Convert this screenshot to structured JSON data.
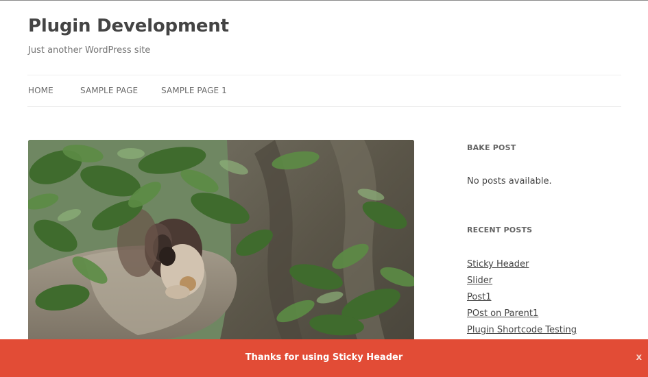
{
  "site": {
    "title": "Plugin Development",
    "tagline": "Just another WordPress site"
  },
  "nav": {
    "items": [
      {
        "label": "HOME"
      },
      {
        "label": "SAMPLE PAGE"
      },
      {
        "label": "SAMPLE PAGE 1"
      }
    ]
  },
  "featured_image": {
    "alt": "squirrel in a tree"
  },
  "sidebar": {
    "bake_post": {
      "title": "BAKE POST",
      "text": "No posts available."
    },
    "recent_posts": {
      "title": "RECENT POSTS",
      "items": [
        {
          "label": "Sticky Header"
        },
        {
          "label": "Slider"
        },
        {
          "label": "Post1"
        },
        {
          "label": "POst on Parent1"
        },
        {
          "label": "Plugin Shortcode Testing"
        }
      ]
    }
  },
  "sticky_header": {
    "message": "Thanks for using Sticky Header",
    "close_label": "x",
    "color": "#e24c36"
  }
}
